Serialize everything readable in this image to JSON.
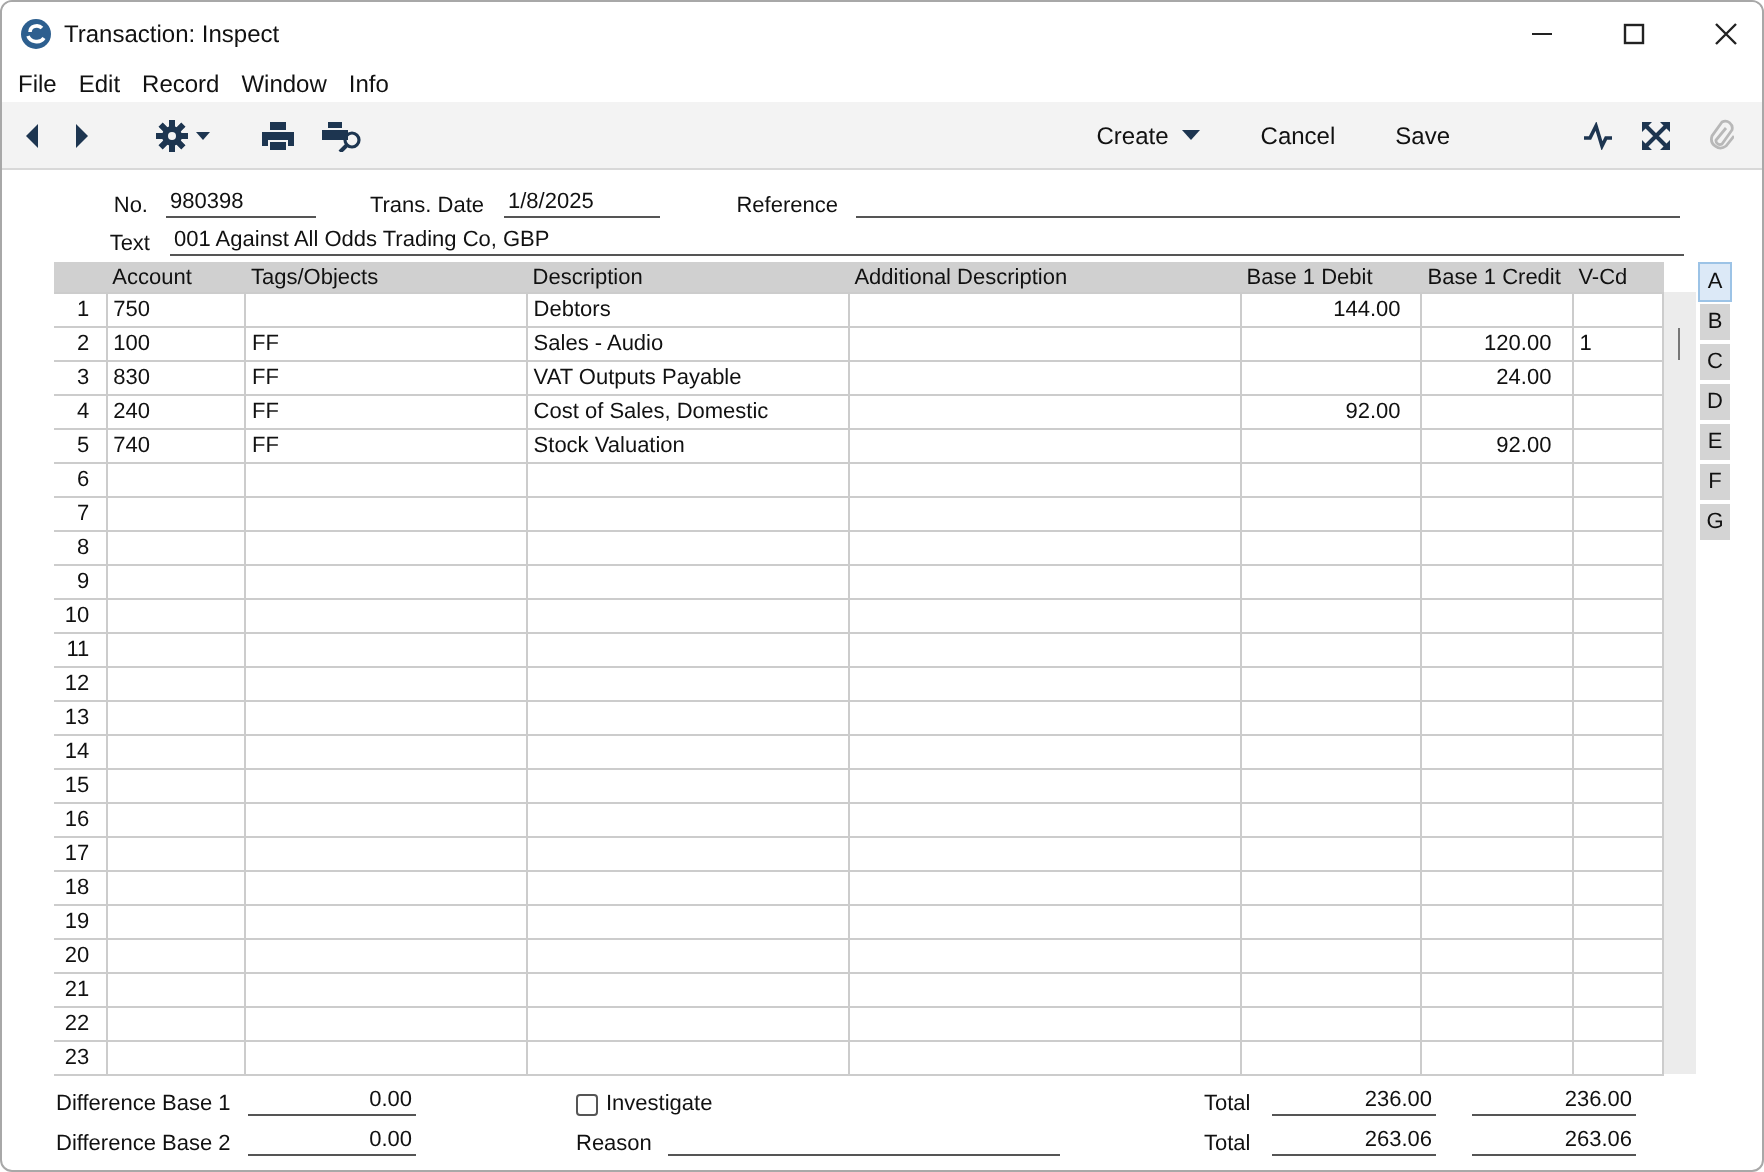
{
  "window": {
    "title": "Transaction: Inspect"
  },
  "menu": [
    "File",
    "Edit",
    "Record",
    "Window",
    "Info"
  ],
  "toolbar": {
    "buttons": [
      {
        "label": "Create",
        "kind": "menu"
      },
      {
        "label": "Cancel",
        "kind": "plain"
      },
      {
        "label": "Save",
        "kind": "plain"
      }
    ],
    "attach_disabled": true
  },
  "header": {
    "no": {
      "label": "No.",
      "value": "980398"
    },
    "trans_date": {
      "label": "Trans. Date",
      "value": "1/8/2025"
    },
    "reference": {
      "label": "Reference"
    },
    "text": {
      "label": "Text",
      "value": "001 Against All Odds Trading Co, GBP"
    }
  },
  "table": {
    "columns": [
      "Account",
      "Tags/Objects",
      "Description",
      "Additional Description",
      "Base 1 Debit",
      "Base 1 Credit",
      "V-Cd"
    ],
    "rows": [
      {
        "no": "1",
        "account": "750",
        "description": "Debtors",
        "debit": "144.00"
      },
      {
        "no": "2",
        "account": "100",
        "tags": "FF",
        "description": "Sales - Audio",
        "credit": "120.00",
        "v_cd": "1"
      },
      {
        "no": "3",
        "account": "830",
        "tags": "FF",
        "description": "VAT Outputs Payable",
        "credit": "24.00"
      },
      {
        "no": "4",
        "account": "240",
        "tags": "FF",
        "description": "Cost of Sales, Domestic",
        "debit": "92.00"
      },
      {
        "no": "5",
        "account": "740",
        "tags": "FF",
        "description": "Stock Valuation",
        "credit": "92.00"
      },
      {
        "no": "6"
      },
      {
        "no": "7"
      },
      {
        "no": "8"
      },
      {
        "no": "9"
      },
      {
        "no": "10"
      },
      {
        "no": "11"
      },
      {
        "no": "12"
      },
      {
        "no": "13"
      },
      {
        "no": "14"
      },
      {
        "no": "15"
      },
      {
        "no": "16"
      },
      {
        "no": "17"
      },
      {
        "no": "18"
      },
      {
        "no": "19"
      },
      {
        "no": "20"
      },
      {
        "no": "21"
      },
      {
        "no": "22"
      },
      {
        "no": "23"
      }
    ]
  },
  "side_tabs": [
    {
      "label": "A",
      "selected": true
    },
    {
      "label": "B",
      "selected": false
    },
    {
      "label": "C",
      "selected": false
    },
    {
      "label": "D",
      "selected": false
    },
    {
      "label": "E",
      "selected": false
    },
    {
      "label": "F",
      "selected": false
    },
    {
      "label": "G",
      "selected": false
    }
  ],
  "footer": {
    "difference_base_1": {
      "label": "Difference Base 1",
      "value": "0.00"
    },
    "difference_base_2": {
      "label": "Difference Base 2",
      "value": "0.00"
    },
    "investigate": {
      "label": "Investigate",
      "checked": false
    },
    "reason": {
      "label": "Reason"
    },
    "totals": [
      {
        "label": "Total",
        "debit": "236.00",
        "credit": "236.00"
      },
      {
        "label": "Total",
        "debit": "263.06",
        "credit": "263.06"
      }
    ]
  }
}
